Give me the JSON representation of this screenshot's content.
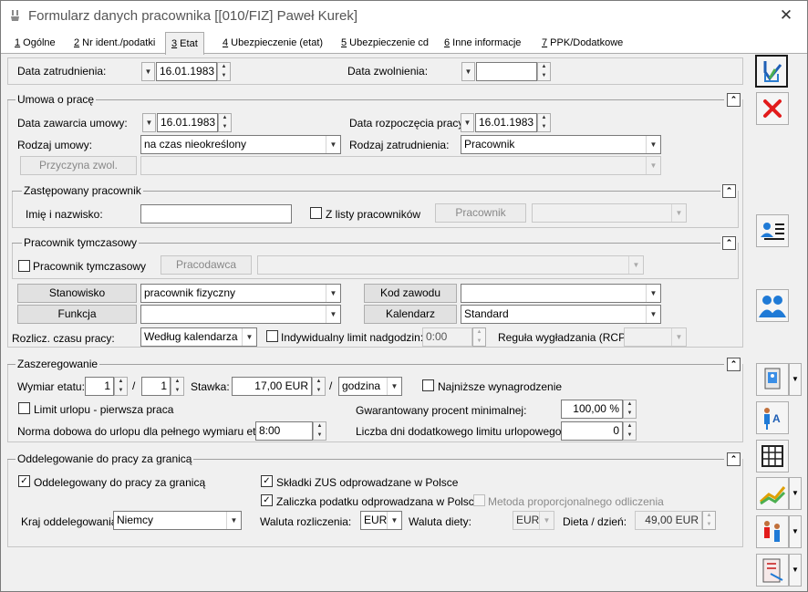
{
  "window": {
    "title": "Formularz danych pracownika [[010/FIZ] Paweł Kurek]",
    "close_glyph": "✕"
  },
  "tabs": [
    {
      "key": "1",
      "label": " Ogólne"
    },
    {
      "key": "2",
      "label": " Nr ident./podatki"
    },
    {
      "key": "3",
      "label": " Etat"
    },
    {
      "key": "4",
      "label": " Ubezpieczenie (etat)"
    },
    {
      "key": "5",
      "label": " Ubezpieczenie cd"
    },
    {
      "key": "6",
      "label": " Inne informacje"
    },
    {
      "key": "7",
      "label": " PPK/Dodatkowe"
    }
  ],
  "top": {
    "hire_date_label": "Data zatrudnienia:",
    "hire_date": "16.01.1983",
    "release_date_label": "Data zwolnienia:",
    "release_date": ""
  },
  "contract": {
    "title": "Umowa o pracę",
    "conclusion_label": "Data zawarcia umowy:",
    "conclusion_date": "16.01.1983",
    "start_label": "Data rozpoczęcia pracy:",
    "start_date": "16.01.1983",
    "type_label": "Rodzaj umowy:",
    "type_value": "na czas nieokreślony",
    "employment_label": "Rodzaj zatrudnienia:",
    "employment_value": "Pracownik",
    "reason_button": "Przyczyna zwol.",
    "replaced": {
      "title": "Zastępowany pracownik",
      "name_label": "Imię i nazwisko:",
      "from_list_label": "Z listy pracowników",
      "employee_button": "Pracownik"
    },
    "temporary": {
      "title": "Pracownik tymczasowy",
      "checkbox_label": "Pracownik tymczasowy",
      "employer_button": "Pracodawca"
    },
    "position_button": "Stanowisko",
    "position_value": "pracownik fizyczny",
    "occupation_code_button": "Kod zawodu",
    "occupation_code_value": "",
    "function_button": "Funkcja",
    "function_value": "",
    "calendar_button": "Kalendarz",
    "calendar_value": "Standard",
    "worktime_label": "Rozlicz. czasu pracy:",
    "worktime_value": "Według kalendarza",
    "overtime_label": "Indywidualny limit nadgodzin:",
    "overtime_value": "0:00",
    "rcp_label": "Reguła wygładzania (RCP):"
  },
  "classification": {
    "title": "Zaszeregowanie",
    "fte_label": "Wymiar etatu:",
    "fte_num": "1",
    "fte_sep": "/",
    "fte_den": "1",
    "rate_label": "Stawka:",
    "rate_value": "17,00 EUR",
    "rate_sep": "/",
    "rate_unit": "godzina",
    "min_wage_label": "Najniższe wynagrodzenie",
    "leave_limit_label": "Limit urlopu - pierwsza praca",
    "guaranteed_label": "Gwarantowany procent minimalnej:",
    "guaranteed_value": "100,00 %",
    "daily_norm_label": "Norma dobowa do urlopu dla pełnego wymiaru etatu:",
    "daily_norm_value": "8:00",
    "extra_days_label": "Liczba dni dodatkowego limitu urlopowego:",
    "extra_days_value": "0"
  },
  "delegation": {
    "title": "Oddelegowanie do pracy za granicą",
    "delegated_label": "Oddelegowany do pracy za granicą",
    "zus_label": "Składki ZUS odprowadzane w Polsce",
    "tax_label": "Zaliczka podatku odprowadzana w Polsce",
    "proportional_label": "Metoda proporcjonalnego odliczenia",
    "country_label": "Kraj oddelegowania:",
    "country_value": "Niemcy",
    "currency_label": "Waluta rozliczenia:",
    "currency_value": "EUR",
    "allowance_currency_label": "Waluta diety:",
    "allowance_currency_value": "EUR",
    "allowance_label": "Dieta / dzień:",
    "allowance_value": "49,00 EUR"
  },
  "check_glyph": "✓",
  "colors": {
    "save": "#1f5fb5",
    "cancel": "#e21b1b",
    "people": "#1f7ad6"
  }
}
